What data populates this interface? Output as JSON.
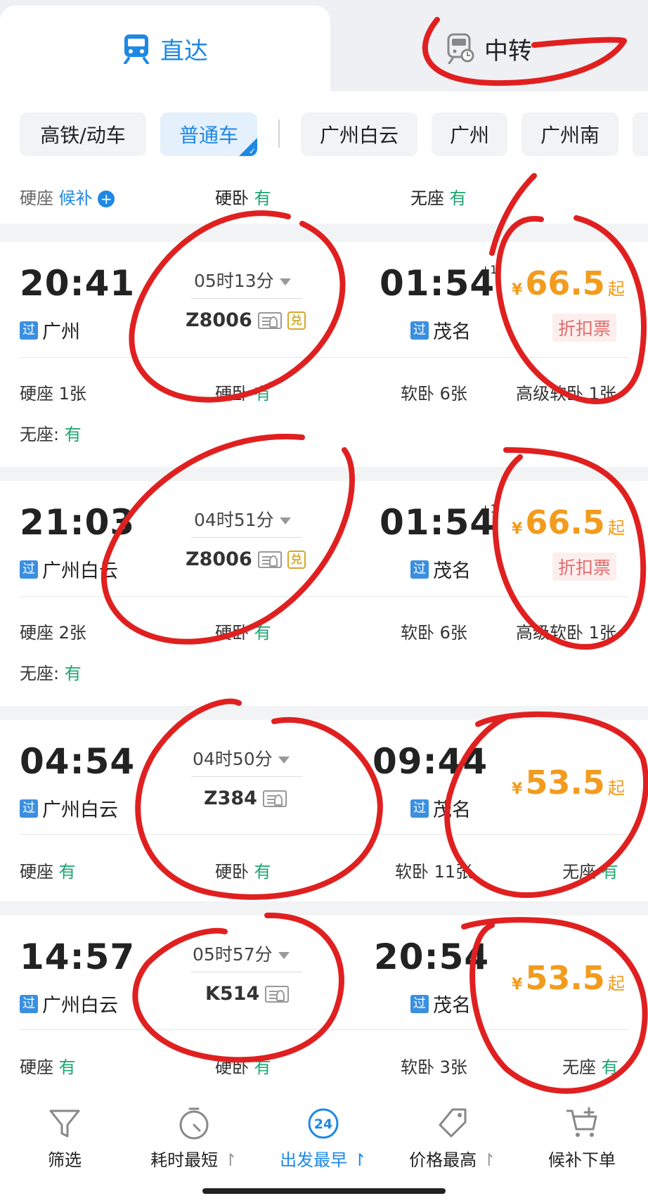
{
  "tabs": [
    {
      "label": "直达",
      "icon": "train-icon",
      "active": true
    },
    {
      "label": "中转",
      "icon": "transfer-train-icon",
      "active": false
    }
  ],
  "chips": [
    {
      "label": "高铁/动车",
      "selected": false
    },
    {
      "label": "普通车",
      "selected": true
    },
    {
      "label": "广州白云",
      "selected": false
    },
    {
      "label": "广州",
      "selected": false
    },
    {
      "label": "广州南",
      "selected": false
    }
  ],
  "summary": {
    "hard_seat": "硬座",
    "hard_seat_action": "候补",
    "hard_sleeper": "硬卧",
    "hard_sleeper_status": "有",
    "no_seat": "无座",
    "no_seat_status": "有"
  },
  "trains": [
    {
      "depart_time": "20:41",
      "depart_badge": "过",
      "depart_station": "广州",
      "duration": "05时13分",
      "train_no": "Z8006",
      "arrive_time": "01:54",
      "cross_day": "+1",
      "arrive_badge": "过",
      "arrive_station": "茂名",
      "price_symbol": "¥",
      "price": "66.5",
      "price_suffix": "起",
      "tag": "折扣票",
      "seats": [
        {
          "name": "硬座",
          "value": "1张"
        },
        {
          "name": "硬卧",
          "value": "有"
        },
        {
          "name": "软卧",
          "value": "6张"
        },
        {
          "name": "高级软卧",
          "value": "1张"
        }
      ],
      "extra": {
        "name": "无座:",
        "value": "有"
      }
    },
    {
      "depart_time": "21:03",
      "depart_badge": "过",
      "depart_station": "广州白云",
      "duration": "04时51分",
      "train_no": "Z8006",
      "arrive_time": "01:54",
      "cross_day": "+1",
      "arrive_badge": "过",
      "arrive_station": "茂名",
      "price_symbol": "¥",
      "price": "66.5",
      "price_suffix": "起",
      "tag": "折扣票",
      "seats": [
        {
          "name": "硬座",
          "value": "2张"
        },
        {
          "name": "硬卧",
          "value": "有"
        },
        {
          "name": "软卧",
          "value": "6张"
        },
        {
          "name": "高级软卧",
          "value": "1张"
        }
      ],
      "extra": {
        "name": "无座:",
        "value": "有"
      }
    },
    {
      "depart_time": "04:54",
      "depart_badge": "过",
      "depart_station": "广州白云",
      "duration": "04时50分",
      "train_no": "Z384",
      "arrive_time": "09:44",
      "arrive_badge": "过",
      "arrive_station": "茂名",
      "price_symbol": "¥",
      "price": "53.5",
      "price_suffix": "起",
      "seats": [
        {
          "name": "硬座",
          "value": "有"
        },
        {
          "name": "硬卧",
          "value": "有"
        },
        {
          "name": "软卧",
          "value": "11张"
        },
        {
          "name": "无座",
          "value": "有"
        }
      ]
    },
    {
      "depart_time": "14:57",
      "depart_badge": "过",
      "depart_station": "广州白云",
      "duration": "05时57分",
      "train_no": "K514",
      "arrive_time": "20:54",
      "arrive_badge": "过",
      "arrive_station": "茂名",
      "price_symbol": "¥",
      "price": "53.5",
      "price_suffix": "起",
      "seats": [
        {
          "name": "硬座",
          "value": "有"
        },
        {
          "name": "硬卧",
          "value": "有"
        },
        {
          "name": "软卧",
          "value": "3张"
        },
        {
          "name": "无座",
          "value": "有"
        }
      ]
    }
  ],
  "bottom_nav": [
    {
      "label": "筛选",
      "icon": "filter-icon",
      "active": false
    },
    {
      "label": "耗时最短",
      "icon": "timer-icon",
      "active": false,
      "sort": "↾"
    },
    {
      "label": "出发最早",
      "icon": "clock-24-icon",
      "active": true,
      "sort": "↾",
      "icon_text": "24"
    },
    {
      "label": "价格最高",
      "icon": "price-tag-icon",
      "active": false,
      "sort": "↾"
    },
    {
      "label": "候补下单",
      "icon": "cart-plus-icon",
      "active": false
    }
  ],
  "colors": {
    "accent": "#1e88e5",
    "available": "#1aa570",
    "price": "#f29b1d",
    "discount": "#e36b6b",
    "annotation": "#e02020"
  }
}
